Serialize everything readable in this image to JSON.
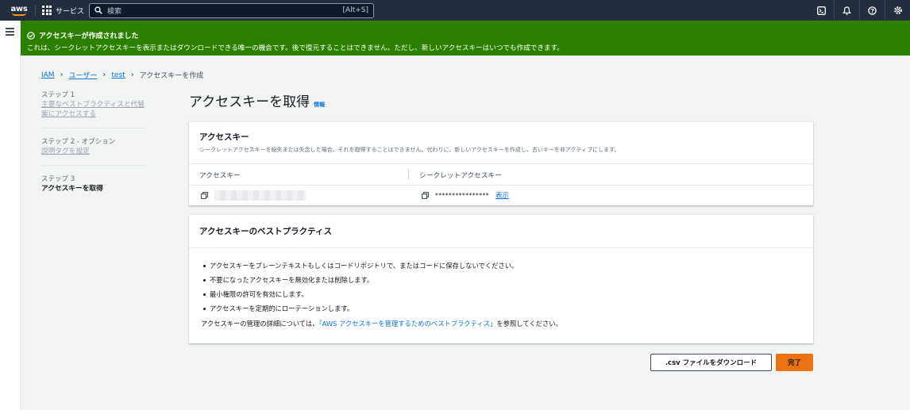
{
  "topnav": {
    "logo": "aws",
    "services_label": "サービス",
    "search_placeholder": "検索",
    "search_shortcut": "[Alt+S]",
    "icons": [
      "cloudshell-icon",
      "notifications-icon",
      "help-icon",
      "settings-icon"
    ]
  },
  "flash": {
    "title": "アクセスキーが作成されました",
    "message": "これは、シークレットアクセスキーを表示またはダウンロードできる唯一の機会です。後で復元することはできません。ただし、新しいアクセスキーはいつでも作成できます。",
    "color": "#2b8000"
  },
  "breadcrumb": {
    "items": [
      "IAM",
      "ユーザー",
      "test"
    ],
    "current": "アクセスキーを作成"
  },
  "steps": [
    {
      "num": "ステップ 1",
      "label": "主要なベストプラクティスと代替案にアクセスする"
    },
    {
      "num": "ステップ 2 - オプション",
      "label": "説明タグを設定"
    },
    {
      "num": "ステップ 3",
      "label": "アクセスキーを取得"
    }
  ],
  "page": {
    "title": "アクセスキーを取得",
    "info": "情報"
  },
  "access_key_panel": {
    "title": "アクセスキー",
    "description": "シークレットアクセスキーを紛失または失念した場合、それを取得することはできません。代わりに、新しいアクセスキーを作成し、古いキーを非アクティブにします。",
    "col_access_key": "アクセスキー",
    "col_secret_key": "シークレットアクセスキー",
    "secret_masked": "****************",
    "show_label": "表示"
  },
  "best_practices": {
    "title": "アクセスキーのベストプラクティス",
    "items": [
      "アクセスキーをプレーンテキストもしくはコードリポジトリで、またはコードに保存しないでください。",
      "不要になったアクセスキーを無効化または削除します。",
      "最小権限の許可を有効にします。",
      "アクセスキーを定期的にローテーションします。"
    ],
    "footer_pre": "アクセスキーの管理の詳細については、",
    "footer_link": "「AWS アクセスキーを管理するためのベストプラクティス」",
    "footer_post": "を参照してください。"
  },
  "buttons": {
    "download_csv": ".csv ファイルをダウンロード",
    "done": "完了",
    "primary_color": "#ec7211"
  }
}
